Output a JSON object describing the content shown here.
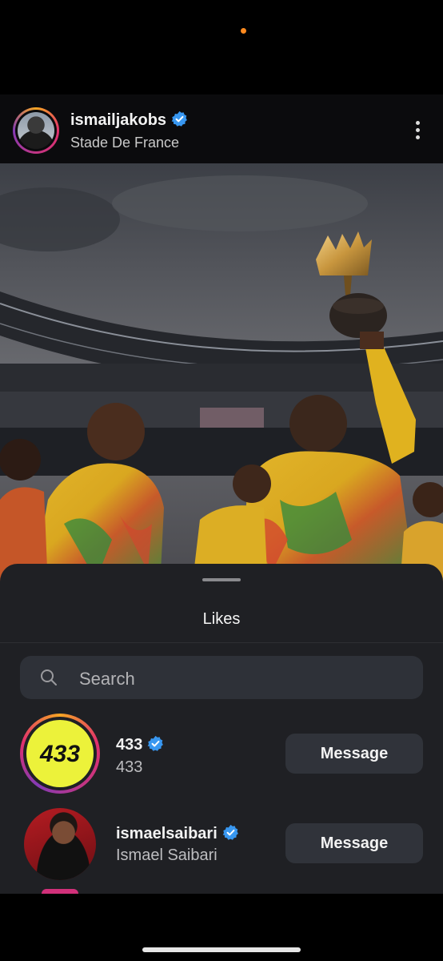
{
  "post": {
    "username": "ismailjakobs",
    "location": "Stade De France"
  },
  "likes_sheet": {
    "title": "Likes",
    "search_placeholder": "Search",
    "users": [
      {
        "username": "433",
        "display_name": "433",
        "verified": true,
        "action_label": "Message"
      },
      {
        "username": "ismaelsaibari",
        "display_name": "Ismael Saibari",
        "verified": true,
        "action_label": "Message"
      }
    ]
  },
  "logo_433_text": "433",
  "colors": {
    "verified_blue": "#3897f0",
    "status_dot": "#ff8a1f",
    "logo_433_bg": "#ecf23a"
  },
  "icons": [
    "verified-badge-icon",
    "more-options-icon",
    "search-icon"
  ]
}
